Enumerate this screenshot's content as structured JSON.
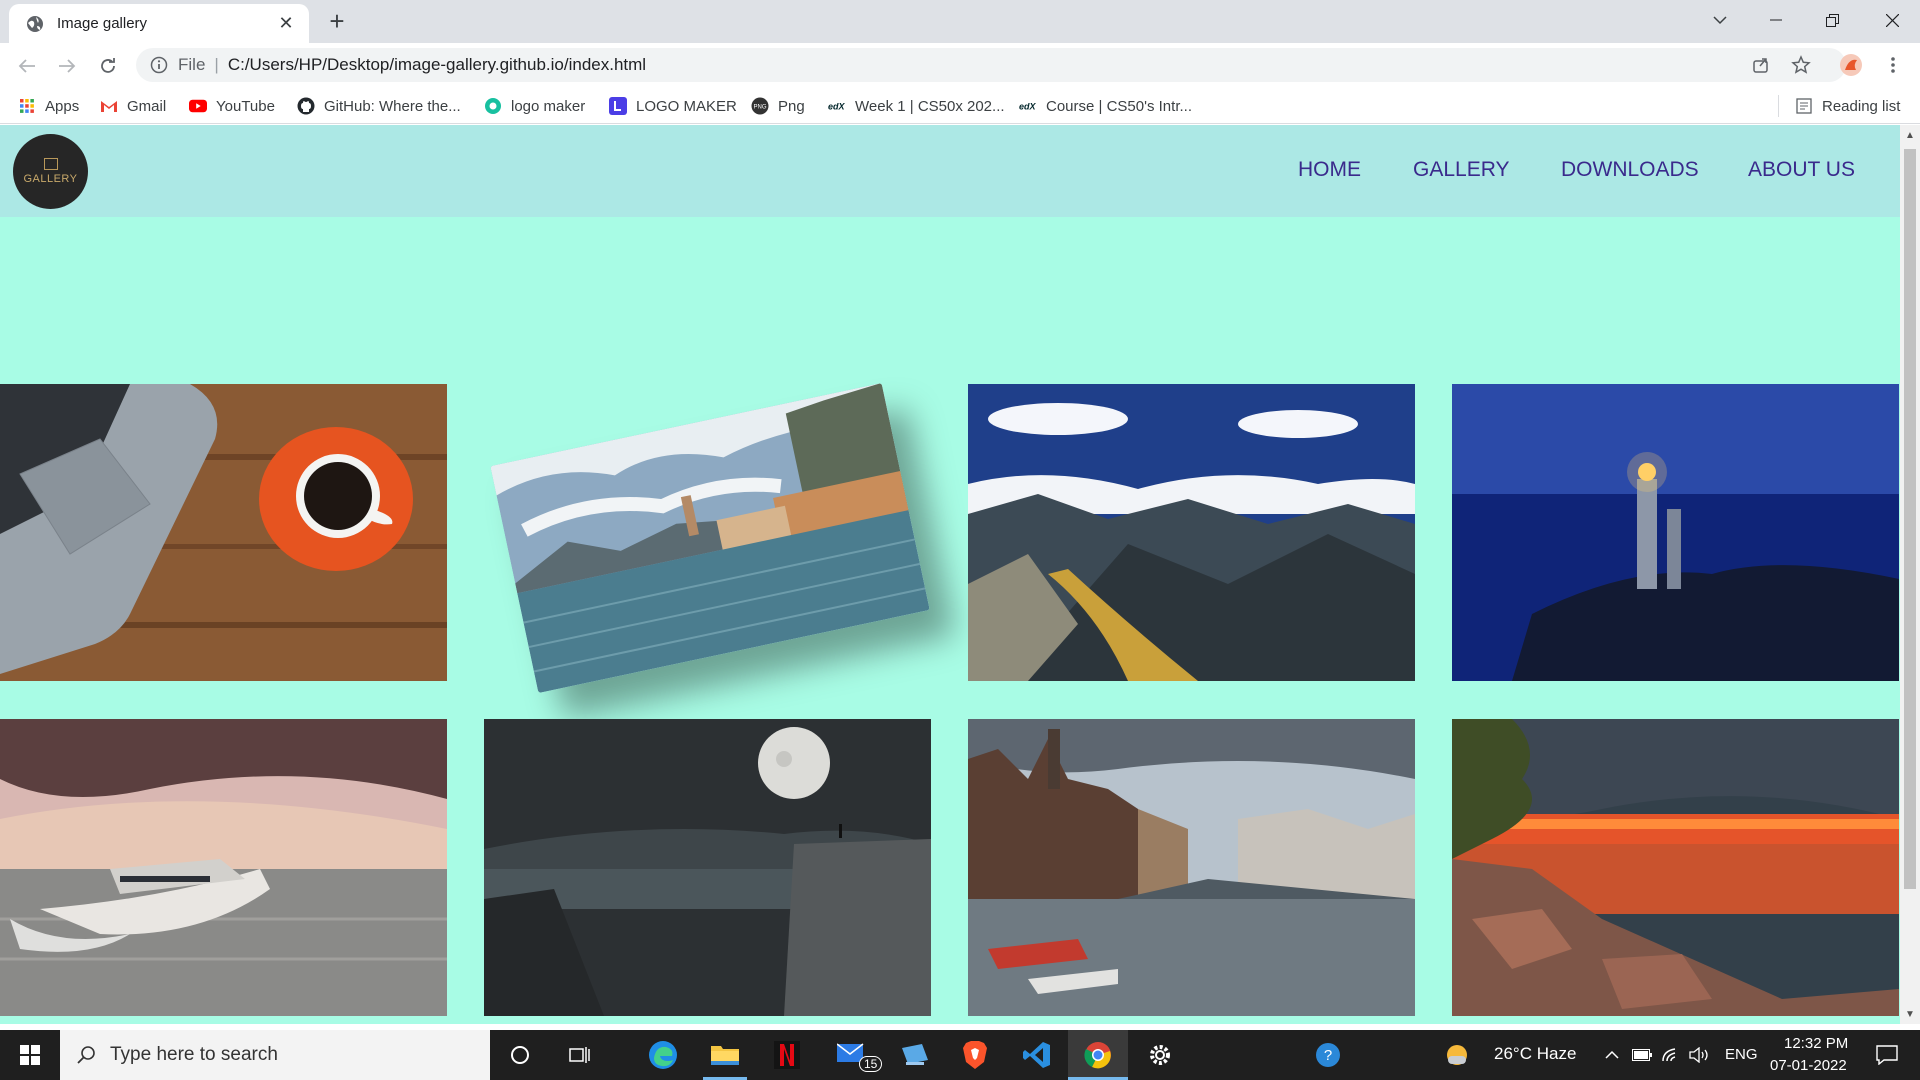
{
  "browser": {
    "tab_title": "Image gallery",
    "scheme_label": "File",
    "url": "C:/Users/HP/Desktop/image-gallery.github.io/index.html",
    "reading_list_label": "Reading list"
  },
  "bookmarks": [
    {
      "label": "Apps",
      "icon": "apps-grid-icon"
    },
    {
      "label": "Gmail",
      "icon": "gmail-icon"
    },
    {
      "label": "YouTube",
      "icon": "youtube-icon"
    },
    {
      "label": "GitHub: Where the...",
      "icon": "github-icon"
    },
    {
      "label": "logo maker",
      "icon": "logo-maker-icon"
    },
    {
      "label": "LOGO MAKER",
      "icon": "logo-maker-square-icon"
    },
    {
      "label": "Png",
      "icon": "png-icon"
    },
    {
      "label": "Week 1 | CS50x 202...",
      "icon": "edx-icon"
    },
    {
      "label": "Course | CS50's Intr...",
      "icon": "edx-icon"
    }
  ],
  "site": {
    "logo_text": "GALLERY",
    "nav": [
      "HOME",
      "GALLERY",
      "DOWNLOADS",
      "ABOUT US"
    ],
    "colors": {
      "page_bg": "#a8fce5",
      "header_bg": "#ace8e5",
      "nav_text": "#3a2a8c"
    }
  },
  "gallery": [
    {
      "subject": "laptop-and-coffee"
    },
    {
      "subject": "lake-town"
    },
    {
      "subject": "mountains"
    },
    {
      "subject": "lighthouse"
    },
    {
      "subject": "speedboat"
    },
    {
      "subject": "moon-cliff"
    },
    {
      "subject": "canal-city"
    },
    {
      "subject": "rocky-sunset"
    }
  ],
  "taskbar": {
    "search_placeholder": "Type here to search",
    "mail_badge": "15",
    "weather": "26°C  Haze",
    "language": "ENG",
    "time": "12:32 PM",
    "date": "07-01-2022"
  }
}
